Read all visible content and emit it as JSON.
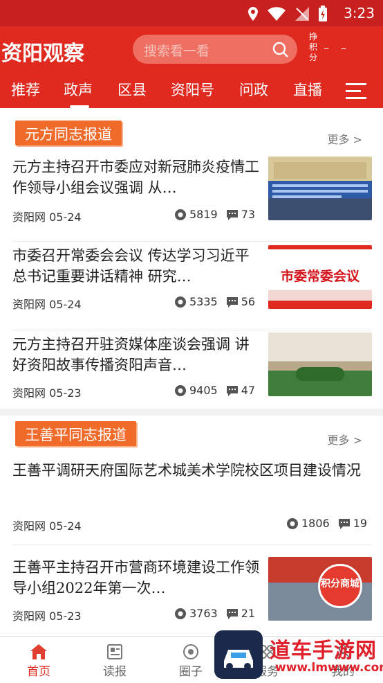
{
  "status_bar": {
    "time": "3:23"
  },
  "header": {
    "logo": "资阳观察",
    "search_placeholder": "搜索看一看",
    "points_label": "挣积分",
    "points_value": "– –",
    "tabs": [
      "推荐",
      "政声",
      "区县",
      "资阳号",
      "问政",
      "直播"
    ],
    "active_tab": "政声"
  },
  "sections": [
    {
      "title": "元方同志报道",
      "more": "更多 >",
      "items": [
        {
          "title": "元方主持召开市委应对新冠肺炎疫情工作领导小组会议强调 从…",
          "source": "资阳网",
          "date": "05-24",
          "views": "5819",
          "comments": "73",
          "thumb_text": ""
        },
        {
          "title": "市委召开常委会会议 传达学习习近平总书记重要讲话精神 研究…",
          "source": "资阳网",
          "date": "05-24",
          "views": "5335",
          "comments": "56",
          "thumb_text": "市委常委会议"
        },
        {
          "title": "元方主持召开驻资媒体座谈会强调 讲好资阳故事传播资阳声音…",
          "source": "资阳网",
          "date": "05-23",
          "views": "9405",
          "comments": "47",
          "thumb_text": ""
        }
      ]
    },
    {
      "title": "王善平同志报道",
      "more": "更多 >",
      "items": [
        {
          "title": "王善平调研天府国际艺术城美术学院校区项目建设情况",
          "source": "资阳网",
          "date": "05-24",
          "views": "1806",
          "comments": "19"
        },
        {
          "title": "王善平主持召开市营商环境建设工作领导小组2022年第一次…",
          "source": "资阳网",
          "date": "05-23",
          "views": "3763",
          "comments": "21",
          "badge": "积分商城"
        }
      ]
    }
  ],
  "bottom_nav": [
    "首页",
    "读报",
    "圈子",
    "服务",
    "我的"
  ],
  "watermark": {
    "text": "道车手游网",
    "url": "www.lmwww.com"
  },
  "colors": {
    "brand_red": "#e02a1f",
    "section_orange": "#f06a2a"
  }
}
